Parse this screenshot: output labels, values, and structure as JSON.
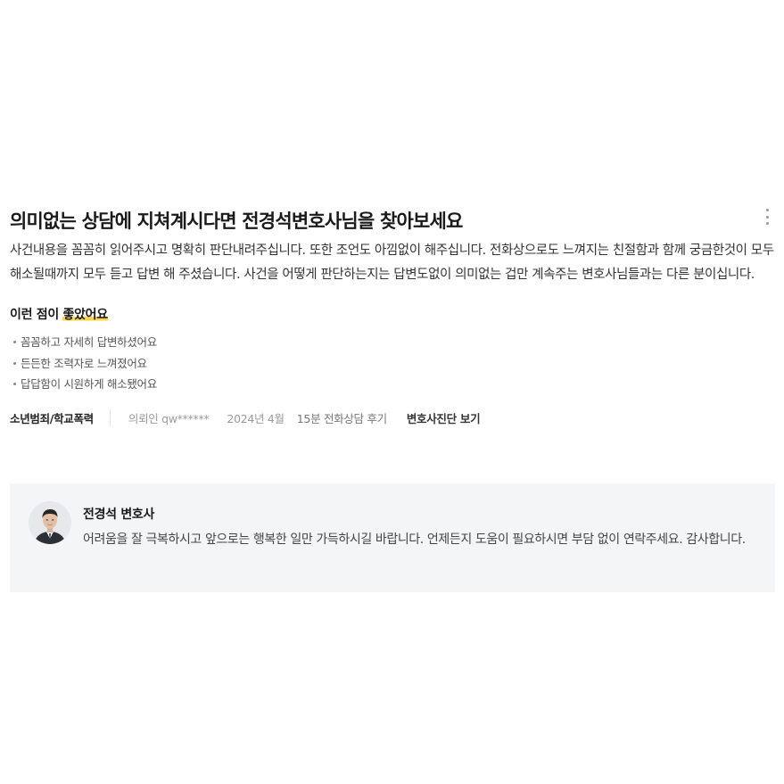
{
  "review": {
    "title": "의미없는 상담에 지쳐계시다면 전경석변호사님을 찾아보세요",
    "body": "사건내용을 꼼꼼히 읽어주시고 명확히 판단내려주십니다. 또한 조언도 아낌없이 해주십니다. 전화상으로도 느껴지는 친절함과 함께 궁금한것이 모두 해소될때까지 모두 듣고 답변 해 주셨습니다. 사건을 어떻게 판단하는지는 답변도없이 의미없는 겁만 계속주는 변호사님들과는 다른 분이십니다.",
    "good_points_prefix": "이런 점이 ",
    "good_points_highlight": "좋았어요",
    "good_points": [
      "꼼꼼하고 자세히 답변하셨어요",
      "든든한 조력자로 느껴졌어요",
      "답답함이 시원하게 해소됐어요"
    ],
    "meta": {
      "category": "소년범죄/학교폭력",
      "user": "의뢰인 qw******",
      "date": "2024년 4월",
      "consult_type": "15분 전화상담 후기",
      "diagnosis_link": "변호사진단 보기"
    }
  },
  "reply": {
    "name": "전경석 변호사",
    "text": "어려움을 잘 극복하시고 앞으로는 행복한 일만 가득하시길 바랍니다. 언제든지 도움이 필요하시면 부담 없이 연락주세요. 감사합니다."
  },
  "icons": {
    "more": "more-vertical-icon",
    "avatar": "lawyer-avatar"
  }
}
